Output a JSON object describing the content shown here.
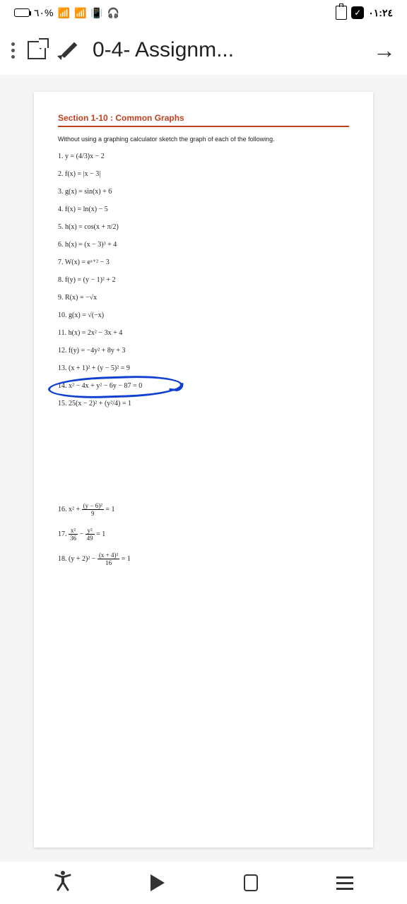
{
  "status": {
    "battery_pct": "٦٠%",
    "time": "٠١:٢٤"
  },
  "header": {
    "title": "0-4- Assignm..."
  },
  "doc": {
    "section_title": "Section 1-10 : Common Graphs",
    "intro": "Without using a graphing calculator sketch the graph of each of the following.",
    "problems": {
      "p1": "1.  y = (4/3)x − 2",
      "p2": "2.  f(x) = |x − 3|",
      "p3": "3.  g(x) = sin(x) + 6",
      "p4": "4.  f(x) = ln(x) − 5",
      "p5_a": "5.  h(x) = cos",
      "p5_b": "x + π/2",
      "p6": "6.  h(x) = (x − 3)³ + 4",
      "p7": "7.  W(x) = eˣ⁺² − 3",
      "p8": "8.  f(y) = (y − 1)² + 2",
      "p9": "9.  R(x) = −√x",
      "p10": "10. g(x) = √(−x)",
      "p11": "11. h(x) = 2x² − 3x + 4",
      "p12": "12. f(y) = −4y² + 8y + 3",
      "p13": "13. (x + 1)² + (y − 5)² = 9",
      "p14": "14. x² − 4x + y² − 6y − 87 = 0",
      "p15": "15. 25(x − 2)² + (y²/4) = 1",
      "p16_a": "16. x² + ",
      "p16_b": "(y − 6)²",
      "p16_c": "9",
      "p16_d": " = 1",
      "p17_a": "17. ",
      "p17_b": "x²",
      "p17_c": "36",
      "p17_d": "y²",
      "p17_e": "49",
      "p17_f": " = 1",
      "p18_a": "18. (y + 2)² − ",
      "p18_b": "(x + 4)²",
      "p18_c": "16",
      "p18_d": " = 1"
    }
  }
}
